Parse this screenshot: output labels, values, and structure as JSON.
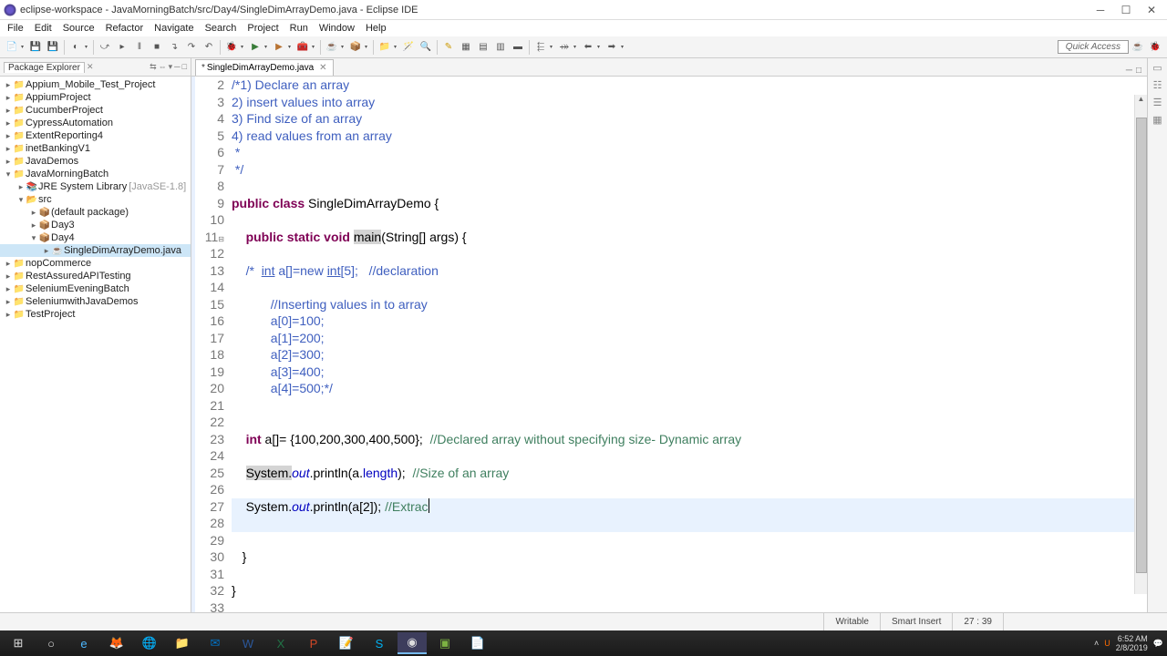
{
  "title": "eclipse-workspace - JavaMorningBatch/src/Day4/SingleDimArrayDemo.java - Eclipse IDE",
  "menuItems": [
    "File",
    "Edit",
    "Source",
    "Refactor",
    "Navigate",
    "Search",
    "Project",
    "Run",
    "Window",
    "Help"
  ],
  "quickAccess": "Quick Access",
  "packageExplorer": "Package Explorer",
  "projects": [
    {
      "name": "Appium_Mobile_Test_Project",
      "icon": "▸"
    },
    {
      "name": "AppiumProject",
      "icon": "▸"
    },
    {
      "name": "CucumberProject",
      "icon": "▸"
    },
    {
      "name": "CypressAutomation",
      "icon": "▸"
    },
    {
      "name": "ExtentReporting4",
      "icon": "▸"
    },
    {
      "name": "inetBankingV1",
      "icon": "▸"
    },
    {
      "name": "JavaDemos",
      "icon": "▸"
    }
  ],
  "expandedProject": "JavaMorningBatch",
  "jre": "JRE System Library",
  "jreTag": "[JavaSE-1.8]",
  "src": "src",
  "defaultPkg": "(default package)",
  "day3": "Day3",
  "day4": "Day4",
  "activeFile": "SingleDimArrayDemo.java",
  "projectsAfter": [
    {
      "name": "nopCommerce"
    },
    {
      "name": "RestAssuredAPITesting"
    },
    {
      "name": "SeleniumEveningBatch"
    },
    {
      "name": "SeleniumwithJavaDemos"
    },
    {
      "name": "TestProject"
    }
  ],
  "editorTab": "SingleDimArrayDemo.java",
  "code": {
    "l2": "/*1) Declare an array",
    "l3": "2) insert values into array",
    "l4": "3) Find size of an array",
    "l5": "4) read values from an array",
    "l6": " *",
    "l7": " */",
    "l9a": "public",
    "l9b": "class",
    "l9c": " SingleDimArrayDemo {",
    "l11a": "public",
    "l11b": "static",
    "l11c": "void",
    "l11d": "main",
    "l11e": "(String[] args) {",
    "l13a": "/*  ",
    "l13b": "int",
    "l13c": " a[]=new ",
    "l13d": "int",
    "l13e": "[5];   //declaration",
    "l15": "       //Inserting values in to array",
    "l16": "       a[0]=100;",
    "l17": "       a[1]=200;",
    "l18": "       a[2]=300;",
    "l19": "       a[3]=400;",
    "l20": "       a[4]=500;*/",
    "l23a": "int",
    "l23b": " a[]= {100,200,300,400,500};  ",
    "l23c": "//Declared array without specifying size- Dynamic array",
    "l25a": "System.",
    "l25b": "out",
    "l25c": ".println(a.",
    "l25d": "length",
    "l25e": ");  ",
    "l25f": "//Size of an array",
    "l27a": "System.",
    "l27b": "out",
    "l27c": ".println(a[2]); ",
    "l27d": "//Extrac",
    "l30": "   }",
    "l32": "}"
  },
  "lineNumbers": [
    "2",
    "3",
    "4",
    "5",
    "6",
    "7",
    "8",
    "9",
    "10",
    "11",
    "12",
    "13",
    "14",
    "15",
    "16",
    "17",
    "18",
    "19",
    "20",
    "21",
    "22",
    "23",
    "24",
    "25",
    "26",
    "27",
    "28",
    "29",
    "30",
    "31",
    "32",
    "33"
  ],
  "status": {
    "writable": "Writable",
    "insert": "Smart Insert",
    "pos": "27 : 39"
  },
  "clock": {
    "time": "6:52 AM",
    "date": "2/8/2019"
  }
}
